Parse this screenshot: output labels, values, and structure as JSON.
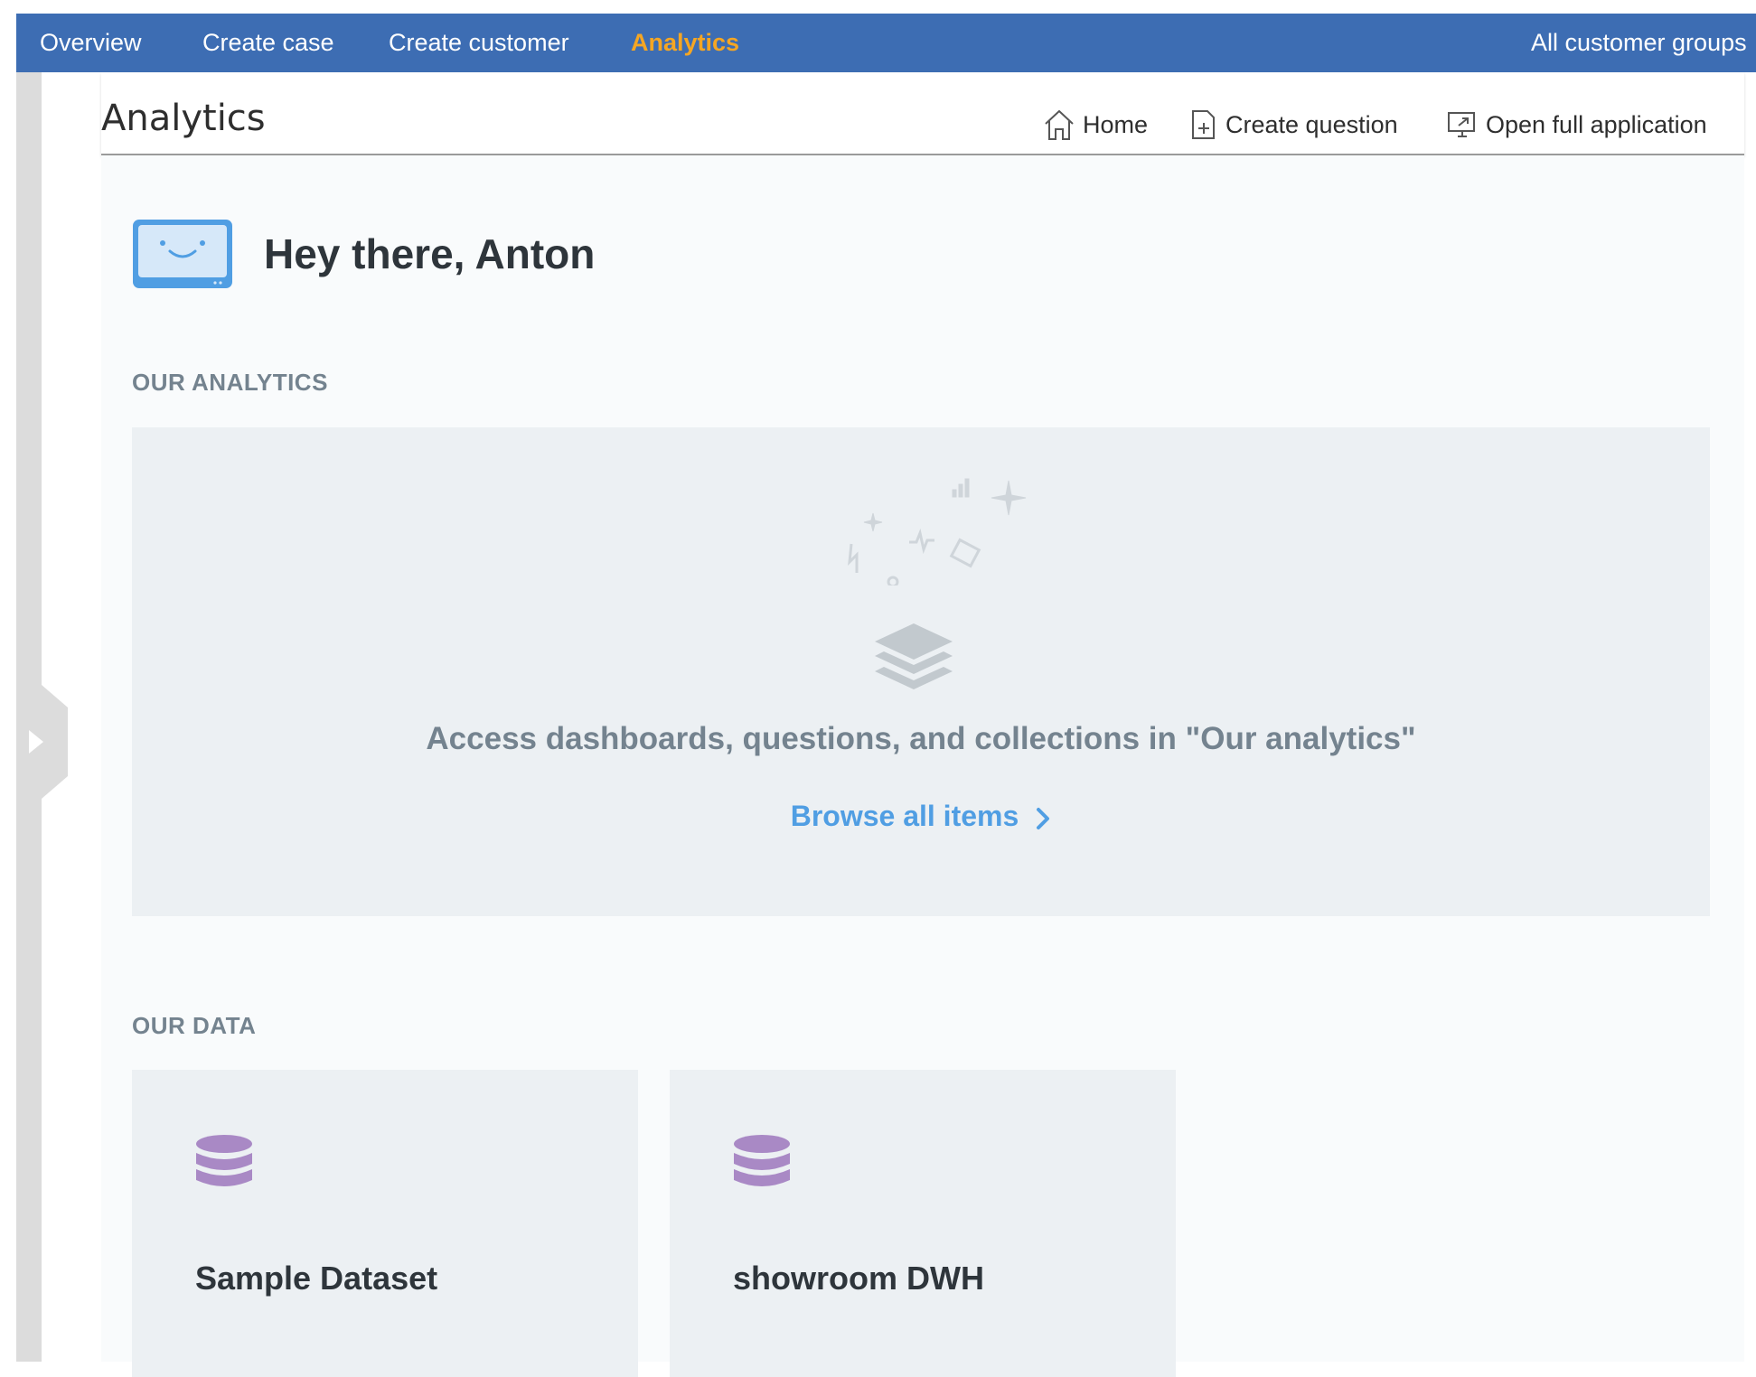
{
  "topnav": {
    "items": [
      {
        "label": "Overview"
      },
      {
        "label": "Create case"
      },
      {
        "label": "Create customer"
      },
      {
        "label": "Analytics",
        "active": true
      }
    ],
    "right_label": "All customer groups"
  },
  "header": {
    "title": "Analytics",
    "actions": [
      {
        "label": "Home",
        "icon": "home-icon"
      },
      {
        "label": "Create question",
        "icon": "create-question-icon"
      },
      {
        "label": "Open full application",
        "icon": "open-app-icon"
      }
    ]
  },
  "greeting": "Hey there, Anton",
  "our_analytics": {
    "heading": "OUR ANALYTICS",
    "empty_message": "Access dashboards, questions, and collections in \"Our analytics\"",
    "browse_label": "Browse all items"
  },
  "our_data": {
    "heading": "OUR DATA",
    "databases": [
      {
        "name": "Sample Dataset",
        "icon": "database-icon"
      },
      {
        "name": "showroom DWH",
        "icon": "database-icon"
      }
    ]
  },
  "colors": {
    "nav_bg": "#3d6db3",
    "nav_active": "#f5a623",
    "link": "#509ee3",
    "database": "#a989c5",
    "muted": "#74838f"
  }
}
